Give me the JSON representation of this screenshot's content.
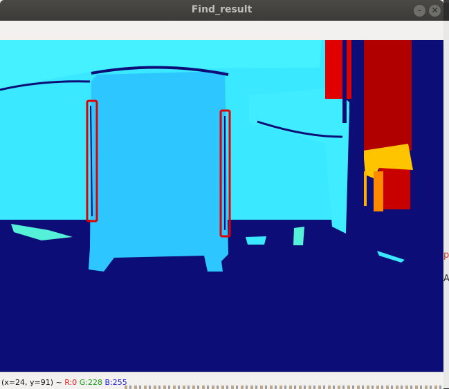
{
  "window": {
    "title": "Find_result"
  },
  "colors": {
    "titlebar": "#3c3b37",
    "depth_background": "#0d0d78",
    "depth_far": "#38e6ff",
    "depth_mid": "#2ec8ff",
    "depth_near_red": "#c40000",
    "depth_yellow": "#ffd400",
    "detection_box": "#e00000"
  },
  "status": {
    "coords": "(x=24, y=91) ~",
    "r": "R:0",
    "g": "G:228",
    "b": "B:255"
  },
  "side_fragments": [
    "p",
    "A"
  ]
}
